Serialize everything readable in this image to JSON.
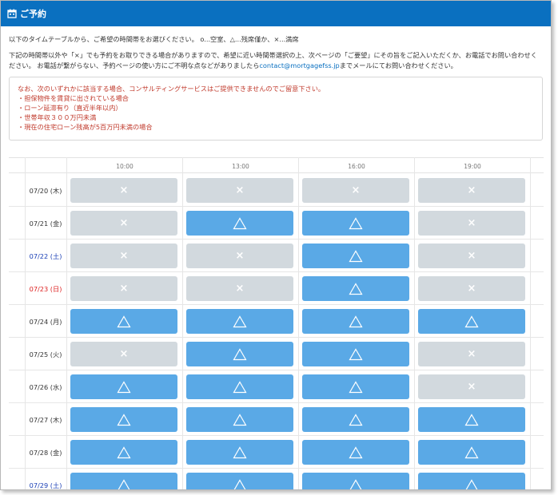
{
  "header": {
    "title": "ご予約",
    "icon": "calendar-icon"
  },
  "intro": {
    "line1": "以下のタイムテーブルから、ご希望の時間帯をお選びください。 o...空室、△...残席僅か、×...満席",
    "line2a": "下記の時間帯以外や「×」でも予約をお取りできる場合がありますので、希望に近い時間帯選択の上、次ページの「ご要望」にその旨をご記入いただくか、お電話でお問い合わせください。 お電話が繋がらない、予約ページの使い方にご不明な点などがありましたら",
    "email": "contact@mortgagefss.jp",
    "line2b": "までメールにてお問い合わせください。"
  },
  "notice": {
    "heading": "なお、次のいずれかに該当する場合、コンサルティングサービスはご提供できませんのでご留意下さい。",
    "items": [
      "・担保物件を賃貸に出されている場合",
      "・ローン延滞有り（直近半年以内）",
      "・世帯年収３００万円未満",
      "・現在の住宅ローン残高が5百万円未満の場合"
    ]
  },
  "times": [
    "10:00",
    "13:00",
    "16:00",
    "19:00"
  ],
  "symbols": {
    "full": "×",
    "few": "△"
  },
  "colors": {
    "header": "#0a70c0",
    "few": "#5aa9e6",
    "full": "#d2d9de",
    "notice": "#c0392b",
    "saturday": "#1a3fb5",
    "sunday": "#dd2222"
  },
  "rows": [
    {
      "date": "07/20 (木)",
      "day": "weekday",
      "slots": [
        "full",
        "full",
        "full",
        "full"
      ]
    },
    {
      "date": "07/21 (金)",
      "day": "weekday",
      "slots": [
        "full",
        "few",
        "few",
        "full"
      ]
    },
    {
      "date": "07/22 (土)",
      "day": "sat",
      "slots": [
        "full",
        "full",
        "few",
        "full"
      ]
    },
    {
      "date": "07/23 (日)",
      "day": "sun",
      "slots": [
        "full",
        "full",
        "few",
        "full"
      ]
    },
    {
      "date": "07/24 (月)",
      "day": "weekday",
      "slots": [
        "few",
        "few",
        "few",
        "few"
      ]
    },
    {
      "date": "07/25 (火)",
      "day": "weekday",
      "slots": [
        "full",
        "few",
        "few",
        "full"
      ]
    },
    {
      "date": "07/26 (水)",
      "day": "weekday",
      "slots": [
        "few",
        "few",
        "few",
        "full"
      ]
    },
    {
      "date": "07/27 (木)",
      "day": "weekday",
      "slots": [
        "few",
        "few",
        "few",
        "few"
      ]
    },
    {
      "date": "07/28 (金)",
      "day": "weekday",
      "slots": [
        "few",
        "few",
        "few",
        "few"
      ]
    },
    {
      "date": "07/29 (土)",
      "day": "sat",
      "slots": [
        "few",
        "few",
        "few",
        "few"
      ]
    }
  ]
}
